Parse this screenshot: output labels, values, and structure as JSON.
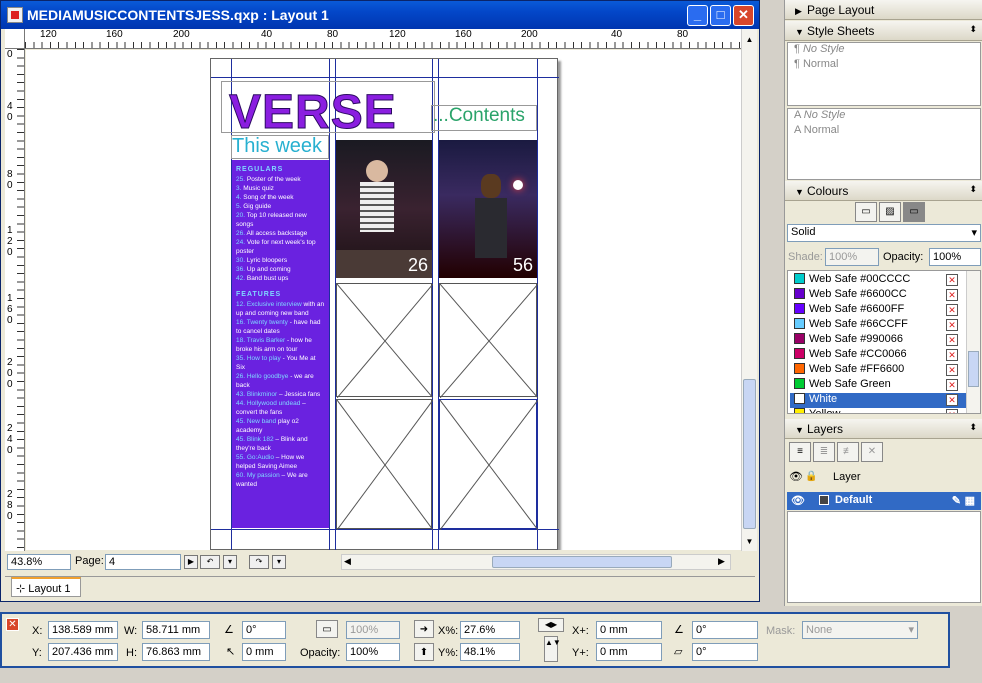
{
  "window": {
    "title": "MEDIAMUSICCONTENTSJESS.qxp : Layout 1",
    "minimize": "_",
    "maximize": "□",
    "close": "✕"
  },
  "ruler_top": [
    "120",
    "160",
    "200",
    "40",
    "80",
    "120",
    "160",
    "200",
    "40",
    "80"
  ],
  "ruler_left": [
    "0",
    "4 0",
    "8 0",
    "1 2 0",
    "1 6 0",
    "2 0 0",
    "2 4 0",
    "2 8 0"
  ],
  "page": {
    "masthead": "VERSE",
    "contents_heading": "...Contents",
    "this_week": "This week",
    "photos": [
      {
        "label": "26"
      },
      {
        "label": "56"
      }
    ],
    "regulars_heading": "REGULARS",
    "regulars": [
      {
        "num": "25.",
        "text": " Poster of the week"
      },
      {
        "num": "3.",
        "text": " Music quiz"
      },
      {
        "num": "4.",
        "text": " Song of the week"
      },
      {
        "num": "5.",
        "text": " Gig guide"
      },
      {
        "num": "20.",
        "text": " Top 10 released new songs"
      },
      {
        "num": "26.",
        "text": " All access backstage"
      },
      {
        "num": "24.",
        "text": " Vote for next week's top poster"
      },
      {
        "num": "30.",
        "text": " Lyric bloopers"
      },
      {
        "num": "36.",
        "text": " Up and coming"
      },
      {
        "num": "42.",
        "text": " Band bust ups"
      }
    ],
    "features_heading": "FEATURES",
    "features": [
      {
        "num": "12. Exclusive interview",
        "text": " with an up and coming new band"
      },
      {
        "num": "16. Twenty twenty",
        "text": " - have had to cancel dates"
      },
      {
        "num": "18. Travis Barker",
        "text": " - how he broke his arm on tour"
      },
      {
        "num": "35. How to play",
        "text": " - You Me at Six"
      },
      {
        "num": "26. Hello goodbye",
        "text": " - we are back"
      },
      {
        "num": "43. Blinkminor",
        "text": " – Jessica fans"
      },
      {
        "num": "44. Hollywood undead",
        "text": " – convert the fans"
      },
      {
        "num": "45. New band",
        "text": " play o2 academy"
      },
      {
        "num": "45. Blink 182",
        "text": " – Blink and they're back"
      },
      {
        "num": "55. Go:Audio",
        "text": " – How we helped Saving Aimee"
      },
      {
        "num": "60. My passion",
        "text": " – We are wanted"
      }
    ]
  },
  "statusbar": {
    "zoom": "43.8%",
    "page_label": "Page:",
    "page_value": "4"
  },
  "tab": {
    "label": "Layout 1"
  },
  "palettes": {
    "page_layout": "Page Layout",
    "style_sheets": "Style Sheets",
    "para_styles": [
      "No Style",
      "Normal"
    ],
    "char_styles": [
      "No Style",
      "Normal"
    ],
    "colours": "Colours",
    "fill_type": "Solid",
    "shade_label": "Shade:",
    "shade_value": "100%",
    "opacity_label": "Opacity:",
    "opacity_value": "100%",
    "colour_list": [
      {
        "name": "Web Safe #00CCCC",
        "hex": "#00cccc"
      },
      {
        "name": "Web Safe #6600CC",
        "hex": "#6600cc"
      },
      {
        "name": "Web Safe #6600FF",
        "hex": "#6600ff"
      },
      {
        "name": "Web Safe #66CCFF",
        "hex": "#66ccff"
      },
      {
        "name": "Web Safe #990066",
        "hex": "#990066"
      },
      {
        "name": "Web Safe #CC0066",
        "hex": "#cc0066"
      },
      {
        "name": "Web Safe #FF6600",
        "hex": "#ff6600"
      },
      {
        "name": "Web Safe Green",
        "hex": "#00cc33"
      },
      {
        "name": "White",
        "hex": "#ffffff"
      },
      {
        "name": "Yellow",
        "hex": "#ffee00"
      }
    ],
    "selected_colour": "White",
    "layers": "Layers",
    "layer_header": "Layer",
    "layer_default": "Default"
  },
  "measurements": {
    "x_label": "X:",
    "x_value": "138.589 mm",
    "y_label": "Y:",
    "y_value": "207.436 mm",
    "w_label": "W:",
    "w_value": "58.711 mm",
    "h_label": "H:",
    "h_value": "76.863 mm",
    "angle_value": "0°",
    "corner_value": "0 mm",
    "shade_value": "100%",
    "opacity_label": "Opacity:",
    "opacity_value": "100%",
    "xpct_label": "X%:",
    "xpct_value": "27.6%",
    "ypct_label": "Y%:",
    "ypct_value": "48.1%",
    "xplus_label": "X+:",
    "xplus_value": "0 mm",
    "yplus_label": "Y+:",
    "yplus_value": "0 mm",
    "rot_value": "0°",
    "skew_value": "0°",
    "mask_label": "Mask:",
    "mask_value": "None"
  },
  "colors": {
    "guide": "#1e2e9e",
    "accent_purple": "#6a22e0",
    "title_blue": "#0346c8"
  }
}
